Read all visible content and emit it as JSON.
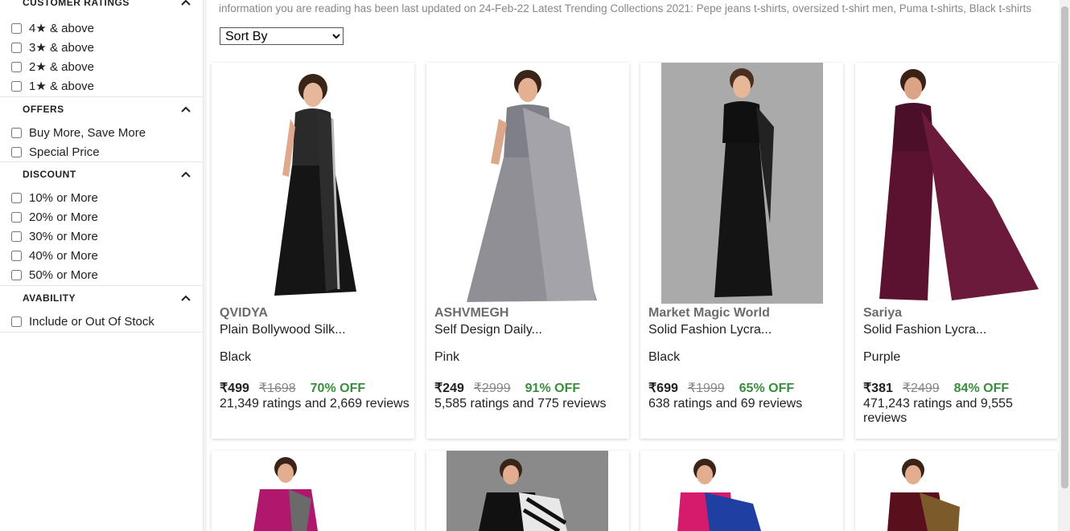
{
  "sidebar": {
    "customer_ratings": {
      "title": "CUSTOMER RATINGS",
      "options": [
        "4★ & above",
        "3★ & above",
        "2★ & above",
        "1★ & above"
      ]
    },
    "offers": {
      "title": "OFFERS",
      "options": [
        "Buy More, Save More",
        "Special Price"
      ]
    },
    "discount": {
      "title": "DISCOUNT",
      "options": [
        "10% or More",
        "20% or More",
        "30% or More",
        "40% or More",
        "50% or More"
      ]
    },
    "availability": {
      "title": "AVABILITY",
      "options": [
        "Include or Out Of Stock"
      ]
    }
  },
  "main": {
    "info_text": "information you are reading has been last updated on 24-Feb-22 Latest Trending Collections 2021: Pepe jeans t-shirts, oversized t-shirt men, Puma t-shirts, Black t-shirts",
    "sort_label": "Sort By",
    "products": [
      {
        "brand": "QVIDYA",
        "title": "Plain Bollywood Silk...",
        "color": "Black",
        "price": "₹499",
        "mrp": "₹1698",
        "off": "70% OFF",
        "ratings": "21,349 ratings and 2,669 reviews",
        "saree_color": "#151515"
      },
      {
        "brand": "ASHVMEGH",
        "title": "Self Design Daily...",
        "color": "Pink",
        "price": "₹249",
        "mrp": "₹2999",
        "off": "91% OFF",
        "ratings": "5,585 ratings and 775 reviews",
        "saree_color": "#8f8f95"
      },
      {
        "brand": "Market Magic World",
        "title": "Solid Fashion Lycra...",
        "color": "Black",
        "price": "₹699",
        "mrp": "₹1999",
        "off": "65% OFF",
        "ratings": "638 ratings and 69 reviews",
        "saree_color": "#141414"
      },
      {
        "brand": "Sariya",
        "title": "Solid Fashion Lycra...",
        "color": "Purple",
        "price": "₹381",
        "mrp": "₹2499",
        "off": "84% OFF",
        "ratings": "471,243 ratings and 9,555 reviews",
        "saree_color": "#5a1230"
      }
    ],
    "second_row": [
      {
        "saree_color": "#b0186e",
        "accent": "#6a6a6a"
      },
      {
        "saree_color": "#e8e8e8",
        "accent": "#111111"
      },
      {
        "saree_color": "#1f3fa3",
        "accent": "#d61b6d"
      },
      {
        "saree_color": "#5a0f1c",
        "accent": "#7c5a2a"
      }
    ]
  }
}
